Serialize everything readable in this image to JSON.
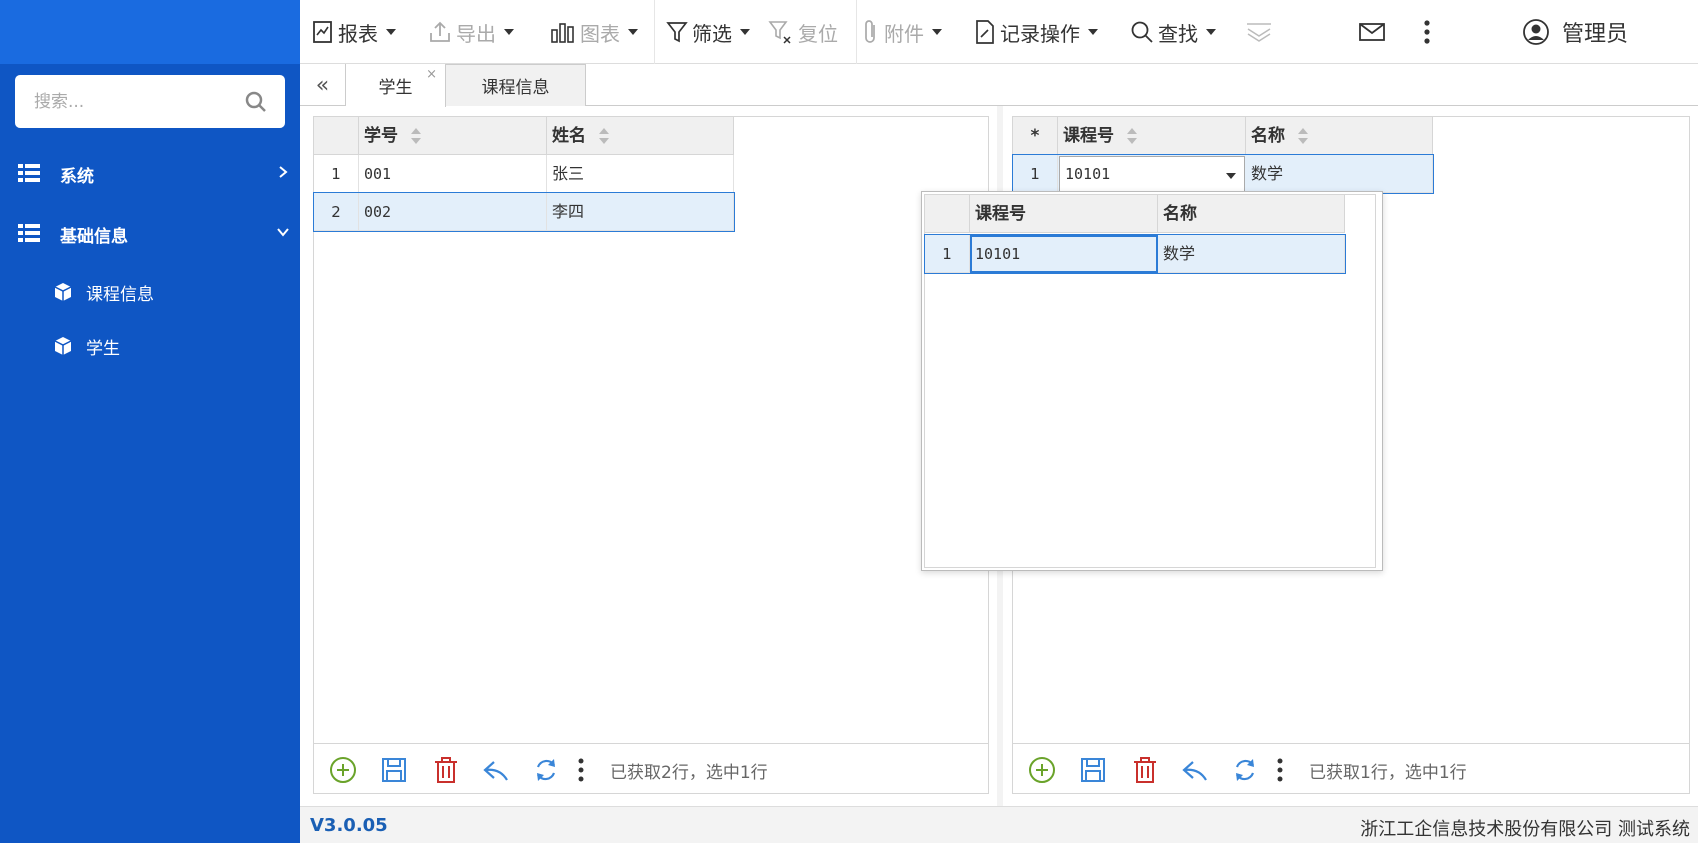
{
  "sidebar": {
    "search_placeholder": "搜索...",
    "items": [
      {
        "label": "系统"
      },
      {
        "label": "基础信息"
      }
    ],
    "sub_items": [
      {
        "label": "课程信息"
      },
      {
        "label": "学生"
      }
    ]
  },
  "toolbar": {
    "report": "报表",
    "export": "导出",
    "chart": "图表",
    "filter": "筛选",
    "reset": "复位",
    "attachment": "附件",
    "record_ops": "记录操作",
    "find": "查找",
    "user": "管理员"
  },
  "tabs": [
    {
      "label": "学生"
    },
    {
      "label": "课程信息"
    }
  ],
  "tab_close": "×",
  "left_grid": {
    "columns": [
      "学号",
      "姓名"
    ],
    "rows": [
      {
        "num": "1",
        "id": "001",
        "name": "张三"
      },
      {
        "num": "2",
        "id": "002",
        "name": "李四"
      }
    ],
    "status": "已获取2行，选中1行"
  },
  "right_grid": {
    "marker": "*",
    "columns": [
      "课程号",
      "名称"
    ],
    "rows": [
      {
        "num": "1",
        "code": "10101",
        "name": "数学"
      }
    ],
    "status": "已获取1行，选中1行"
  },
  "popup_grid": {
    "columns": [
      "课程号",
      "名称"
    ],
    "rows": [
      {
        "num": "1",
        "code": "10101",
        "name": "数学"
      }
    ]
  },
  "statusbar": {
    "version": "V3.0.05",
    "company": "浙江工企信息技术股份有限公司 测试系统"
  },
  "colors": {
    "sidebar": "#0f56c4",
    "accent": "#2b7bd6",
    "add": "#6aa32a",
    "delete": "#c9302c"
  }
}
